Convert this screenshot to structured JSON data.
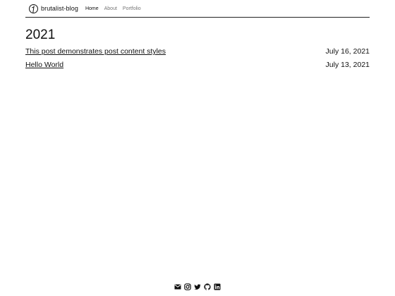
{
  "header": {
    "site_title": "brutalist-blog",
    "nav": [
      "Home",
      "About",
      "Portfolio"
    ],
    "active_nav": "Home"
  },
  "main": {
    "year": "2021",
    "posts": [
      {
        "title": "This post demonstrates post content styles",
        "date": "July 16, 2021"
      },
      {
        "title": "Hello World",
        "date": "July 13, 2021"
      }
    ]
  },
  "footer": {
    "icons": [
      "mail-icon",
      "instagram-icon",
      "twitter-icon",
      "github-icon",
      "linkedin-icon"
    ]
  }
}
